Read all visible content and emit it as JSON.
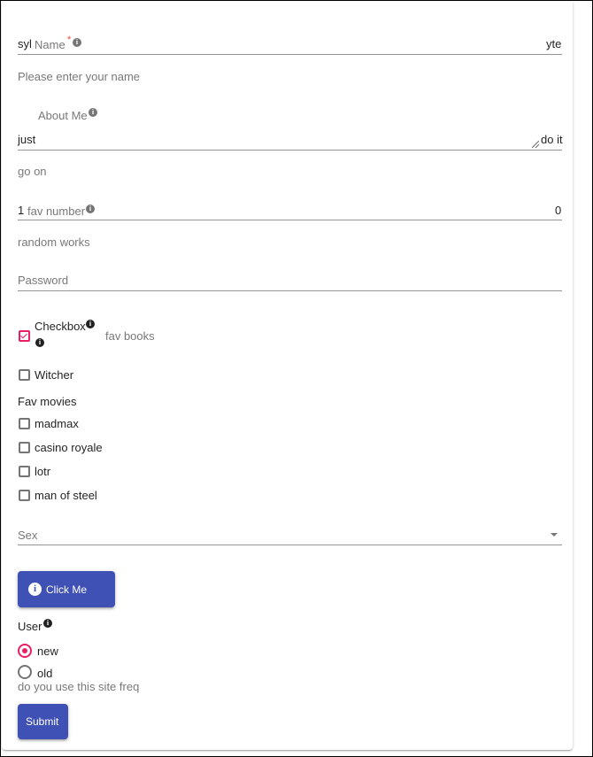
{
  "name_field": {
    "prefix": "syl",
    "label": "Name",
    "required_mark": "*",
    "suffix": "yte",
    "helper": "Please enter your name"
  },
  "about_field": {
    "label": "About Me",
    "value": "just",
    "suffix": "do it",
    "helper": "go on"
  },
  "fav_number_field": {
    "prefix": "1",
    "label": "fav number",
    "value": "0",
    "helper": "random works"
  },
  "password_field": {
    "label": "Password"
  },
  "fav_books": {
    "checkbox_label": "Checkbox",
    "checked": true,
    "legend": "fav books",
    "witcher_label": "Witcher",
    "witcher_checked": false
  },
  "fav_movies": {
    "legend": "Fav movies",
    "items": [
      {
        "label": "madmax",
        "checked": false
      },
      {
        "label": "casino royale",
        "checked": false
      },
      {
        "label": "lotr",
        "checked": false
      },
      {
        "label": "man of steel",
        "checked": false
      }
    ]
  },
  "sex_select": {
    "label": "Sex"
  },
  "click_button": {
    "label": "Click Me",
    "icon": "info-icon"
  },
  "user_radio": {
    "legend": "User",
    "options": [
      {
        "label": "new",
        "selected": true
      },
      {
        "label": "old",
        "selected": false
      }
    ],
    "helper": "do you use this site freq"
  },
  "submit_button": {
    "label": "Submit"
  },
  "colors": {
    "primary": "#3f51b5",
    "accent": "#e91e63"
  }
}
